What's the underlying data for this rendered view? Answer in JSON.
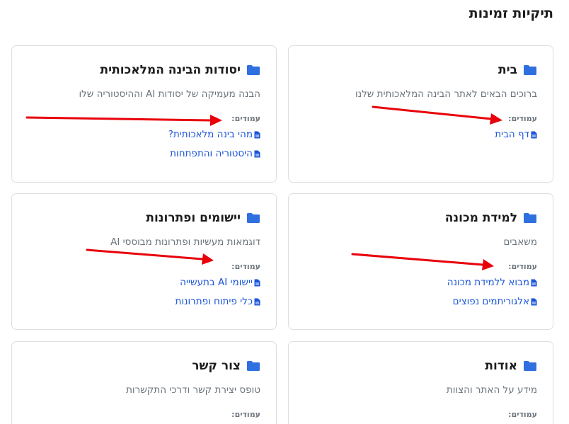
{
  "page": {
    "title": "תיקיות זמינות"
  },
  "pages_label": "עמודים:",
  "colors": {
    "folder": "#2f6fe0",
    "link": "#1a55d8",
    "arrow": "#e8000b"
  },
  "cards": [
    {
      "title": "בית",
      "description": "ברוכים הבאים לאתר הבינה המלאכותית שלנו",
      "pages": [
        {
          "label": "דף הבית"
        }
      ]
    },
    {
      "title": "יסודות הבינה המלאכותית",
      "description": "הבנה מעמיקה של יסודות AI וההיסטוריה שלו",
      "pages": [
        {
          "label": "מהי בינה מלאכותית?"
        },
        {
          "label": "היסטוריה והתפתחות"
        }
      ]
    },
    {
      "title": "למידת מכונה",
      "description": "משאבים",
      "pages": [
        {
          "label": "מבוא ללמידת מכונה"
        },
        {
          "label": "אלגוריתמים נפוצים"
        }
      ]
    },
    {
      "title": "יישומים ופתרונות",
      "description": "דוגמאות מעשיות ופתרונות מבוססי AI",
      "pages": [
        {
          "label": "יישומי AI בתעשייה"
        },
        {
          "label": "כלי פיתוח ופתרונות"
        }
      ]
    },
    {
      "title": "אודות",
      "description": "מידע על האתר והצוות",
      "pages": []
    },
    {
      "title": "צור קשר",
      "description": "טופס יצירת קשר ודרכי התקשרות",
      "pages": []
    }
  ]
}
